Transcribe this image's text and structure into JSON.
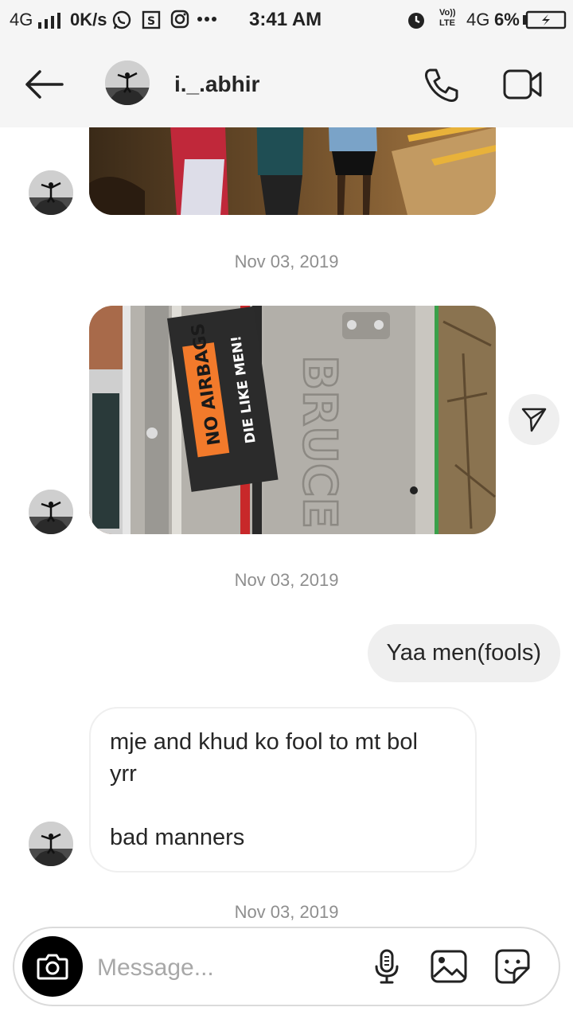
{
  "status_bar": {
    "network": "4G",
    "speed": "0K/s",
    "time": "3:41 AM",
    "volte_top": "Vo))",
    "volte_bottom": "LTE",
    "network2": "4G",
    "battery": "6%"
  },
  "header": {
    "username": "i._.abhir"
  },
  "messages": {
    "date_1": "Nov 03, 2019",
    "date_2": "Nov 03, 2019",
    "date_3": "Nov 03, 2019",
    "outgoing_1": "Yaa men(fools)",
    "incoming_1_line1": "mje and khud ko fool to mt bol",
    "incoming_1_line2": "yrr",
    "incoming_1_line3": "bad manners"
  },
  "sticker": {
    "line1": "NO AIRBAGS",
    "line2": "DIE LIKE MEN!",
    "embossed": "BRUCE"
  },
  "composer": {
    "placeholder": "Message..."
  },
  "icons": {
    "back": "arrow-left-icon",
    "call": "phone-icon",
    "video": "video-camera-icon",
    "share": "send-paper-plane-icon",
    "camera": "camera-icon",
    "mic": "microphone-icon",
    "gallery": "image-gallery-icon",
    "sticker": "sticker-icon"
  },
  "colors": {
    "header_bg": "#f5f5f5",
    "bubble_out_bg": "#efefef",
    "date_text": "#8e8e8e",
    "sticker_orange": "#f27a2b"
  }
}
